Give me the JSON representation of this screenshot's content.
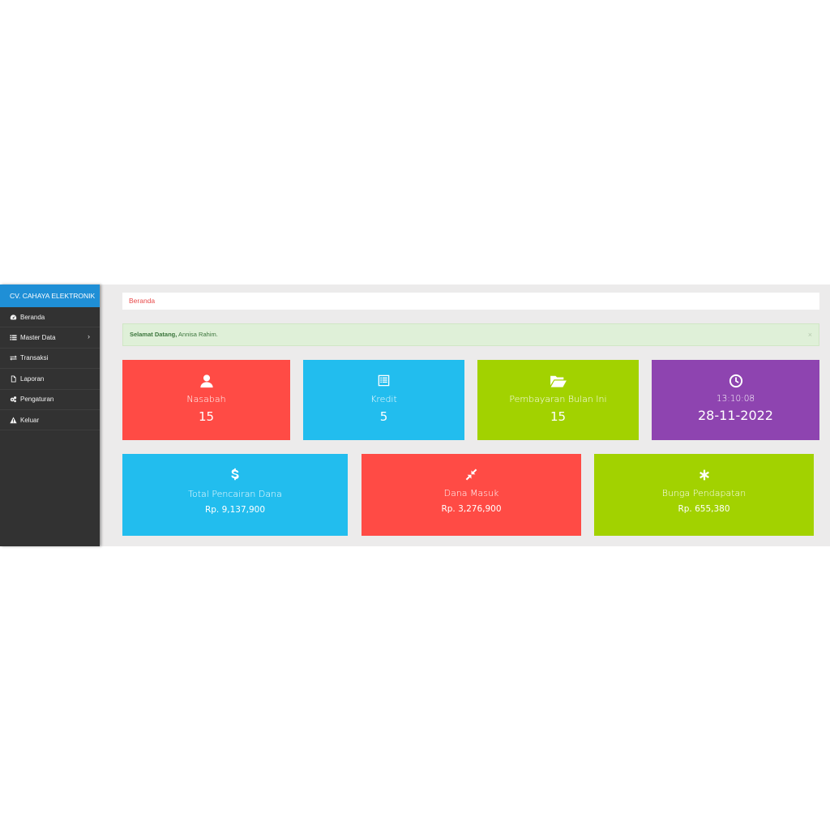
{
  "brand": "CV. CAHAYA ELEKTRONIK",
  "sidebar": {
    "items": [
      {
        "label": "Beranda",
        "icon": "dashboard-icon"
      },
      {
        "label": "Master Data",
        "icon": "list-icon"
      },
      {
        "label": "Transaksi",
        "icon": "exchange-icon"
      },
      {
        "label": "Laporan",
        "icon": "file-icon"
      },
      {
        "label": "Pengaturan",
        "icon": "cogs-icon"
      },
      {
        "label": "Keluar",
        "icon": "warning-icon"
      }
    ],
    "chevron": "›"
  },
  "breadcrumb": "Beranda",
  "alert": {
    "strong": "Selamat Datang,",
    "text": " Annisa Rahim.",
    "close": "×"
  },
  "stats": [
    {
      "label": "Nasabah",
      "value": "15",
      "icon": "user-icon",
      "color": "#ff4b45"
    },
    {
      "label": "Kredit",
      "value": "5",
      "icon": "list-alt-icon",
      "color": "#22bdee"
    },
    {
      "label": "Pembayaran Bulan Ini",
      "value": "15",
      "icon": "folder-open-icon",
      "color": "#a2d200"
    },
    {
      "label": "13:10:08",
      "value": "28-11-2022",
      "icon": "clock-icon",
      "color": "#8e44b0"
    }
  ],
  "summary": [
    {
      "label": "Total Pencairan Dana",
      "value": "Rp. 9,137,900",
      "icon": "dollar-icon",
      "color": "#22bdee"
    },
    {
      "label": "Dana Masuk",
      "value": "Rp. 3,276,900",
      "icon": "compress-icon",
      "color": "#ff4b45"
    },
    {
      "label": "Bunga Pendapatan",
      "value": "Rp. 655,380",
      "icon": "asterisk-icon",
      "color": "#a2d200"
    }
  ]
}
